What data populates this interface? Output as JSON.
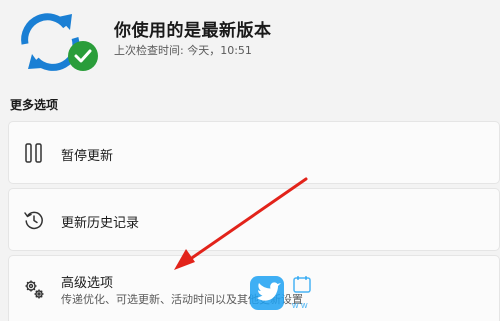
{
  "status": {
    "title": "你使用的是最新版本",
    "subtitle": "上次检查时间: 今天，10:51",
    "icon": "sync-check-icon",
    "colors": {
      "sync_blue": "#1a7fd4",
      "check_green": "#2a9d3a"
    }
  },
  "more_options": {
    "heading": "更多选项",
    "items": [
      {
        "label": "暂停更新",
        "icon": "pause-icon"
      },
      {
        "label": "更新历史记录",
        "icon": "history-icon"
      },
      {
        "label": "高级选项",
        "description": "传递优化、可选更新、活动时间以及其他更新设置",
        "icon": "gears-icon"
      }
    ]
  },
  "annotation": {
    "arrow_color": "#e2231a"
  },
  "watermark": {
    "logo": "twitter-bird-logo",
    "text": "w w"
  }
}
